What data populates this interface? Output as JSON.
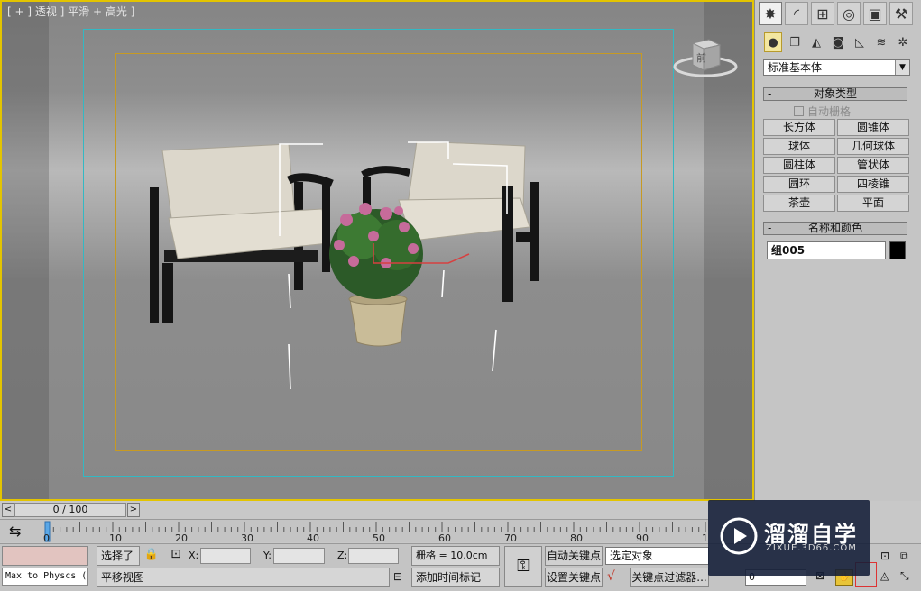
{
  "viewport": {
    "label": "[ + ] 透视 ] 平滑 + 高光 ]",
    "viewcube_label": "前"
  },
  "command_panel": {
    "tabs": [
      "create-icon",
      "modify-icon",
      "hierarchy-icon",
      "motion-icon",
      "display-icon",
      "utilities-icon"
    ],
    "subtabs": [
      "geometry-icon",
      "shapes-icon",
      "lights-icon",
      "cameras-icon",
      "helpers-icon",
      "spacewarps-icon",
      "systems-icon"
    ],
    "category_dropdown": "标准基本体",
    "object_type": {
      "title": "对象类型",
      "auto_grid": "自动栅格",
      "buttons": [
        "长方体",
        "圆锥体",
        "球体",
        "几何球体",
        "圆柱体",
        "管状体",
        "圆环",
        "四棱锥",
        "茶壶",
        "平面"
      ]
    },
    "name_color": {
      "title": "名称和颜色",
      "name_value": "组005",
      "color": "#000000"
    }
  },
  "timeline": {
    "frame_display": "0 / 100",
    "prev_label": "<",
    "next_label": ">",
    "ticks": [
      "0",
      "10",
      "20",
      "30",
      "40",
      "50",
      "60",
      "70",
      "80",
      "90",
      "10"
    ]
  },
  "status_bar": {
    "script_listener": "Max to Physcs (",
    "selection": "选择了",
    "x_label": "X:",
    "y_label": "Y:",
    "z_label": "Z:",
    "grid": "栅格 = 10.0cm",
    "prompt": "平移视图",
    "add_time_tag": "添加时间标记",
    "auto_key": "自动关键点",
    "set_key": "设置关键点",
    "selected_object": "选定对象",
    "key_filters": "关键点过滤器...",
    "frame_field": "0"
  },
  "watermark": {
    "brand": "溜溜自学",
    "url": "ZIXUE.3D66.COM"
  },
  "colors": {
    "viewport_border": "#e3c400",
    "safe_frame_outer": "#32b9c4",
    "safe_frame_inner": "#c79a22",
    "active_subtab": "#f3e7a0"
  }
}
